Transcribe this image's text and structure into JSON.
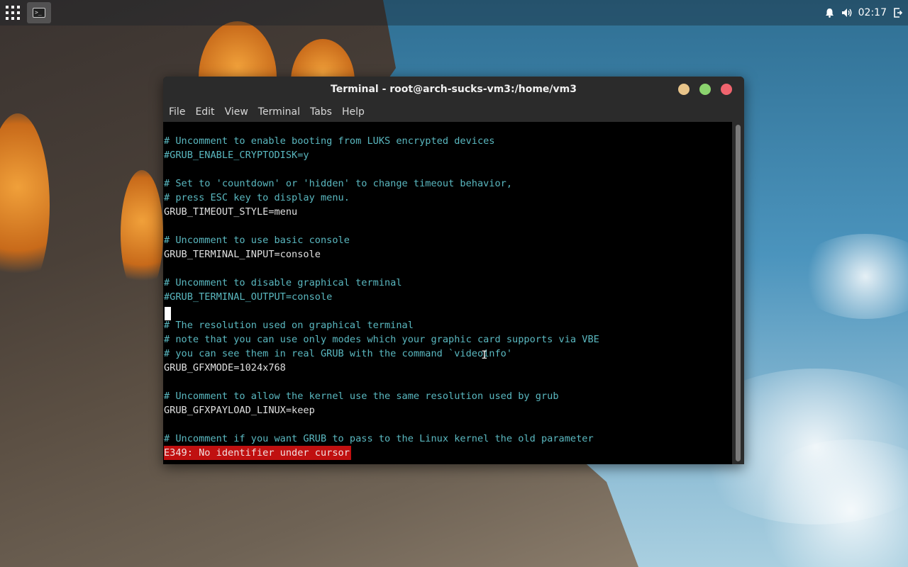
{
  "panel": {
    "apps_icon": "apps-grid-icon",
    "task_icon": "terminal-icon",
    "task_glyph": ">_",
    "clock": "02:17",
    "tray_icons": [
      "bell-icon",
      "volume-icon",
      "logout-icon"
    ]
  },
  "terminal": {
    "title": "Terminal - root@arch-sucks-vm3:/home/vm3",
    "menu": [
      "File",
      "Edit",
      "View",
      "Terminal",
      "Tabs",
      "Help"
    ],
    "window_buttons": [
      "minimize-button",
      "maximize-button",
      "close-button"
    ],
    "lines": [
      {
        "text": "# Uncomment to enable booting from LUKS encrypted devices",
        "kind": "comment"
      },
      {
        "text": "#GRUB_ENABLE_CRYPTODISK=y",
        "kind": "comment"
      },
      {
        "text": "",
        "kind": "normal"
      },
      {
        "text": "# Set to 'countdown' or 'hidden' to change timeout behavior,",
        "kind": "comment"
      },
      {
        "text": "# press ESC key to display menu.",
        "kind": "comment"
      },
      {
        "text": "GRUB_TIMEOUT_STYLE=menu",
        "kind": "normal"
      },
      {
        "text": "",
        "kind": "normal"
      },
      {
        "text": "# Uncomment to use basic console",
        "kind": "comment"
      },
      {
        "text": "GRUB_TERMINAL_INPUT=console",
        "kind": "normal"
      },
      {
        "text": "",
        "kind": "normal"
      },
      {
        "text": "# Uncomment to disable graphical terminal",
        "kind": "comment"
      },
      {
        "text": "#GRUB_TERMINAL_OUTPUT=console",
        "kind": "comment"
      },
      {
        "text": "",
        "kind": "normal"
      },
      {
        "text": "# The resolution used on graphical terminal",
        "kind": "comment"
      },
      {
        "text": "# note that you can use only modes which your graphic card supports via VBE",
        "kind": "comment"
      },
      {
        "text": "# you can see them in real GRUB with the command `videoinfo'",
        "kind": "comment"
      },
      {
        "text": "GRUB_GFXMODE=1024x768",
        "kind": "normal"
      },
      {
        "text": "",
        "kind": "normal"
      },
      {
        "text": "# Uncomment to allow the kernel use the same resolution used by grub",
        "kind": "comment"
      },
      {
        "text": "GRUB_GFXPAYLOAD_LINUX=keep",
        "kind": "normal"
      },
      {
        "text": "",
        "kind": "normal"
      },
      {
        "text": "# Uncomment if you want GRUB to pass to the Linux kernel the old parameter",
        "kind": "comment"
      }
    ],
    "status_error": "E349: No identifier under cursor"
  },
  "colors": {
    "comment": "#5ab8c0",
    "error_bg": "#c01010",
    "close": "#f0646e",
    "maximize": "#8bd46e",
    "minimize": "#e8c48a"
  }
}
